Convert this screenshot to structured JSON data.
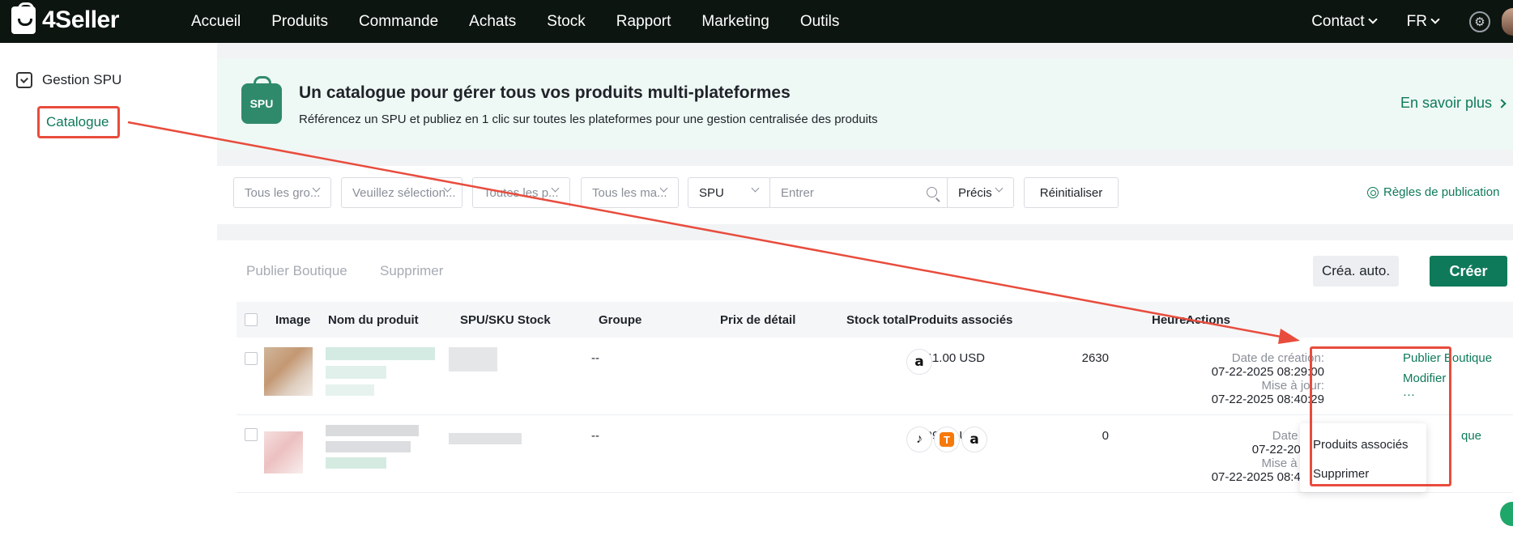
{
  "topbar": {
    "logo": "4Seller",
    "nav": [
      "Accueil",
      "Produits",
      "Commande",
      "Achats",
      "Stock",
      "Rapport",
      "Marketing",
      "Outils"
    ],
    "contact": "Contact",
    "lang": "FR"
  },
  "sidebar": {
    "section": "Gestion SPU",
    "item": "Catalogue"
  },
  "banner": {
    "badge": "SPU",
    "title": "Un catalogue pour gérer tous vos produits multi-plateformes",
    "subtitle": "Référencez un SPU et publiez en 1 clic sur toutes les plateformes pour une gestion centralisée des produits",
    "learn_more": "En savoir plus"
  },
  "filters": {
    "groups": "Tous les gro...",
    "select": "Veuillez sélection...",
    "platforms": "Toutes les p...",
    "brands": "Tous les ma...",
    "search_field": "SPU",
    "search_placeholder": "Entrer",
    "match": "Précis",
    "reset": "Réinitialiser",
    "rules": "Règles de publication"
  },
  "toolbar": {
    "publish_shop": "Publier Boutique",
    "delete": "Supprimer",
    "auto_create": "Créa. auto.",
    "create": "Créer"
  },
  "table": {
    "headers": {
      "image": "Image",
      "name": "Nom du produit",
      "spu_sku": "SPU/SKU Stock",
      "group": "Groupe",
      "price": "Prix de détail",
      "stock": "Stock total",
      "assoc": "Produits associés",
      "time": "Heure",
      "actions": "Actions"
    },
    "rows": [
      {
        "group": "--",
        "price": "11.00 USD",
        "stock": "2630",
        "created_label": "Date de création:",
        "created": "07-22-2025 08:29:00",
        "updated_label": "Mise à jour:",
        "updated": "07-22-2025 08:40:29",
        "action_publish": "Publier Boutique",
        "action_edit": "Modifier",
        "action_more": "···"
      },
      {
        "group": "--",
        "price": "29.99 USD",
        "stock": "0",
        "created_label": "Date de c",
        "created": "07-22-2025 0",
        "updated_label": "Mise à jour:",
        "updated": "07-22-2025 08:40:25",
        "action_publish_partial": "que",
        "action_more": "···"
      }
    ]
  },
  "menu": {
    "assoc": "Produits associés",
    "delete": "Supprimer"
  },
  "colors": {
    "brand": "#0f7a5a",
    "highlight": "#e84c3d",
    "topbar": "#0d1510"
  }
}
